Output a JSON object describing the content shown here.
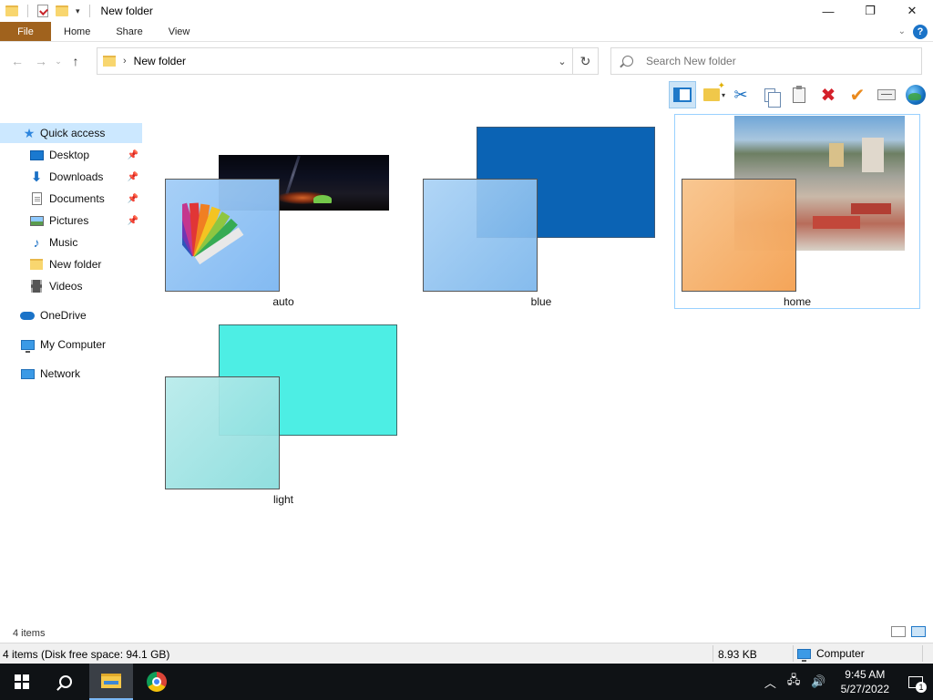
{
  "window": {
    "title": "New folder",
    "controls": {
      "minimize": "—",
      "maximize": "❐",
      "close": "✕"
    }
  },
  "ribbon": {
    "tabs": [
      "File",
      "Home",
      "Share",
      "View"
    ],
    "help": "?"
  },
  "address": {
    "path": "New folder",
    "separator": "›"
  },
  "search": {
    "placeholder": "Search New folder"
  },
  "toolbar": {
    "icons": [
      "preview-pane-icon",
      "new-folder-icon",
      "cut-icon",
      "copy-icon",
      "paste-icon",
      "delete-icon",
      "check-icon",
      "rename-icon",
      "globe-icon"
    ]
  },
  "nav": {
    "quick_access": "Quick access",
    "items": [
      {
        "label": "Desktop",
        "icon": "desktop-icon",
        "pinned": true
      },
      {
        "label": "Downloads",
        "icon": "downloads-icon",
        "pinned": true
      },
      {
        "label": "Documents",
        "icon": "documents-icon",
        "pinned": true
      },
      {
        "label": "Pictures",
        "icon": "pictures-icon",
        "pinned": true
      },
      {
        "label": "Music",
        "icon": "music-icon",
        "pinned": false
      },
      {
        "label": "New folder",
        "icon": "folder-icon",
        "pinned": false
      },
      {
        "label": "Videos",
        "icon": "videos-icon",
        "pinned": false
      }
    ],
    "onedrive": "OneDrive",
    "computer": "My Computer",
    "network": "Network"
  },
  "files": [
    {
      "name": "auto",
      "overlay_color": "#8ec3f7",
      "image_color": "#0c0c14"
    },
    {
      "name": "blue",
      "overlay_color": "#8ac0ee",
      "image_color": "#0b63b4"
    },
    {
      "name": "home",
      "overlay_color": "#f5a85f",
      "image_color": "#7f95a6"
    },
    {
      "name": "light",
      "overlay_color": "#9be2e2",
      "image_color": "#4deee4"
    }
  ],
  "status": {
    "item_count": "4 items",
    "disk_info": "4 items (Disk free space: 94.1 GB)",
    "size": "8.93 KB",
    "location": "Computer"
  },
  "taskbar": {
    "time": "9:45 AM",
    "date": "5/27/2022",
    "notification_count": "1"
  }
}
